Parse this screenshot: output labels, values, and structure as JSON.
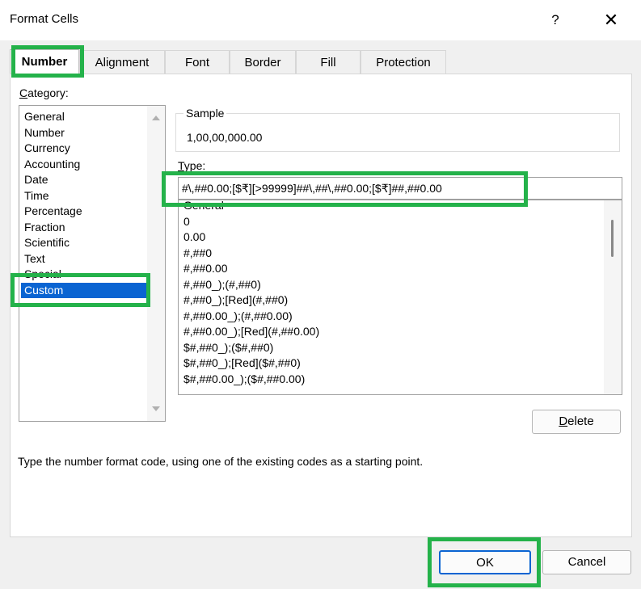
{
  "dialog": {
    "title": "Format Cells",
    "help_label": "?",
    "close_label": "✕"
  },
  "tabs": [
    {
      "label": "Number",
      "active": true
    },
    {
      "label": "Alignment",
      "active": false
    },
    {
      "label": "Font",
      "active": false
    },
    {
      "label": "Border",
      "active": false
    },
    {
      "label": "Fill",
      "active": false
    },
    {
      "label": "Protection",
      "active": false
    }
  ],
  "category": {
    "label_first": "C",
    "label_rest": "ategory:",
    "items": [
      "General",
      "Number",
      "Currency",
      "Accounting",
      "Date",
      "Time",
      "Percentage",
      "Fraction",
      "Scientific",
      "Text",
      "Special",
      "Custom"
    ],
    "selected": "Custom"
  },
  "sample": {
    "label": "Sample",
    "value": "1,00,00,000.00"
  },
  "type": {
    "label_first": "T",
    "label_rest": "ype:",
    "value": "#\\,##0.00;[$₹][>99999]##\\,##\\,##0.00;[$₹]##,##0.00",
    "items": [
      "General",
      "0",
      "0.00",
      "#,##0",
      "#,##0.00",
      "#,##0_);(#,##0)",
      "#,##0_);[Red](#,##0)",
      "#,##0.00_);(#,##0.00)",
      "#,##0.00_);[Red](#,##0.00)",
      "$#,##0_);($#,##0)",
      "$#,##0_);[Red]($#,##0)",
      "$#,##0.00_);($#,##0.00)"
    ]
  },
  "buttons": {
    "delete_first": "D",
    "delete_rest": "elete",
    "ok": "OK",
    "cancel": "Cancel"
  },
  "hint": "Type the number format code, using one of the existing codes as a starting point.",
  "colors": {
    "highlight": "#24b24a",
    "selection": "#0a64d2"
  }
}
